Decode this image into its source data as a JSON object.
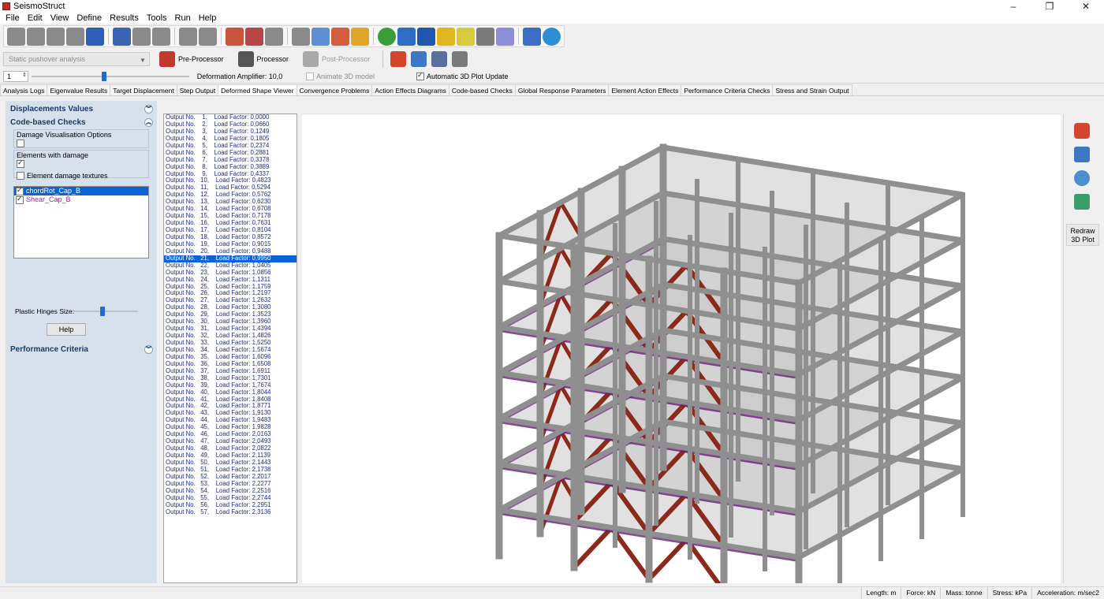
{
  "window": {
    "title": "SeismoStruct",
    "controls": [
      "–",
      "❐",
      "✕"
    ]
  },
  "menu": [
    "File",
    "Edit",
    "View",
    "Define",
    "Results",
    "Tools",
    "Run",
    "Help"
  ],
  "toolbar": {
    "analysis_type": "Static pushover analysis",
    "preprocessor_label": "Pre-Processor",
    "processor_label": "Processor",
    "postprocessor_label": "Post-Processor",
    "step_value": "1",
    "deformation_amplifier": "Deformation Amplifier: 10,0",
    "animate_label": "Animate 3D model",
    "auto_update_label": "Automatic 3D Plot Update",
    "auto_update_checked": true,
    "step_slider_level": 0.46
  },
  "tabs": [
    "Analysis Logs",
    "Eigenvalue Results",
    "Target Displacement",
    "Step Output",
    "Deformed Shape Viewer",
    "Convergence Problems",
    "Action Effects Diagrams",
    "Code-based Checks",
    "Global Response Parameters",
    "Element Action Effects",
    "Performance Criteria Checks",
    "Stress and Strain Output"
  ],
  "active_tab": "Deformed Shape Viewer",
  "left_panel": {
    "displacements_title": "Displacements Values",
    "code_checks_title": "Code-based Checks",
    "damage_vis_label": "Damage Visualisation Options",
    "elements_damage_label": "Elements with damage",
    "element_textures_label": "Element damage textures",
    "checks": [
      {
        "label": "chordRot_Cap_B",
        "checked": true,
        "selected": true
      },
      {
        "label": "Shear_Cap_B",
        "checked": true,
        "selected": false
      }
    ],
    "plastic_hinges_label": "Plastic Hinges Size:",
    "plastic_hinges_level": 0.45,
    "help_label": "Help",
    "performance_title": "Performance Criteria"
  },
  "outputs": {
    "selected_index": 20,
    "rows": [
      "Output No.    1,    Load Factor: 0,0000",
      "Output No.    2,    Load Factor: 0,0660",
      "Output No.    3,    Load Factor: 0,1249",
      "Output No.    4,    Load Factor: 0,1805",
      "Output No.    5,    Load Factor: 0,2374",
      "Output No.    6,    Load Factor: 0,2881",
      "Output No.    7,    Load Factor: 0,3378",
      "Output No.    8,    Load Factor: 0,3889",
      "Output No.    9,    Load Factor: 0,4337",
      "Output No.   10,    Load Factor: 0,4823",
      "Output No.   11,    Load Factor: 0,5294",
      "Output No.   12,    Load Factor: 0,5762",
      "Output No.   13,    Load Factor: 0,6230",
      "Output No.   14,    Load Factor: 0,6708",
      "Output No.   15,    Load Factor: 0,7178",
      "Output No.   16,    Load Factor: 0,7631",
      "Output No.   17,    Load Factor: 0,8104",
      "Output No.   18,    Load Factor: 0,8572",
      "Output No.   19,    Load Factor: 0,9015",
      "Output No.   20,    Load Factor: 0,9488",
      "Output No.   21,    Load Factor: 0,9950",
      "Output No.   22,    Load Factor: 1,0405",
      "Output No.   23,    Load Factor: 1,0856",
      "Output No.   24,    Load Factor: 1,1311",
      "Output No.   25,    Load Factor: 1,1759",
      "Output No.   26,    Load Factor: 1,2197",
      "Output No.   27,    Load Factor: 1,2632",
      "Output No.   28,    Load Factor: 1,3080",
      "Output No.   29,    Load Factor: 1,3523",
      "Output No.   30,    Load Factor: 1,3960",
      "Output No.   31,    Load Factor: 1,4394",
      "Output No.   32,    Load Factor: 1,4826",
      "Output No.   33,    Load Factor: 1,5250",
      "Output No.   34,    Load Factor: 1,5674",
      "Output No.   35,    Load Factor: 1,6096",
      "Output No.   36,    Load Factor: 1,6508",
      "Output No.   37,    Load Factor: 1,6911",
      "Output No.   38,    Load Factor: 1,7301",
      "Output No.   39,    Load Factor: 1,7674",
      "Output No.   40,    Load Factor: 1,8044",
      "Output No.   41,    Load Factor: 1,8408",
      "Output No.   42,    Load Factor: 1,8771",
      "Output No.   43,    Load Factor: 1,9130",
      "Output No.   44,    Load Factor: 1,9483",
      "Output No.   45,    Load Factor: 1,9828",
      "Output No.   46,    Load Factor: 2,0163",
      "Output No.   47,    Load Factor: 2,0493",
      "Output No.   48,    Load Factor: 2,0822",
      "Output No.   49,    Load Factor: 2,1139",
      "Output No.   50,    Load Factor: 2,1443",
      "Output No.   51,    Load Factor: 2,1738",
      "Output No.   52,    Load Factor: 2,2017",
      "Output No.   53,    Load Factor: 2,2277",
      "Output No.   54,    Load Factor: 2,2516",
      "Output No.   55,    Load Factor: 2,2744",
      "Output No.   56,    Load Factor: 2,2951",
      "Output No.   57,    Load Factor: 2,3136"
    ]
  },
  "viewport": {
    "colors": {
      "frame": "#8f8f8f",
      "slab": "#c9c9c9",
      "brace": "#8b2a1a",
      "damage": "#6a1b7a"
    }
  },
  "right_tools": {
    "redraw_label": "Redraw 3D Plot",
    "icons": [
      "colour-palette-icon",
      "checklist-icon",
      "axes-icon",
      "layers-icon"
    ]
  },
  "statusbar": [
    "Length: m",
    "Force: kN",
    "Mass: tonne",
    "Stress: kPa",
    "Acceleration: m/sec2"
  ]
}
